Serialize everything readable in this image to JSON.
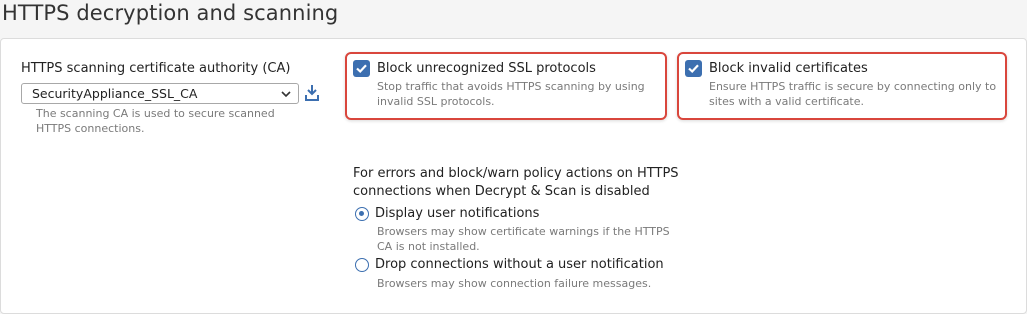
{
  "page": {
    "title": "HTTPS decryption and scanning"
  },
  "ca": {
    "label": "HTTPS scanning certificate authority (CA)",
    "selected": "SecurityAppliance_SSL_CA",
    "help": "The scanning CA is used to secure scanned HTTPS connections.",
    "download_icon": "download-icon"
  },
  "options": {
    "block_ssl": {
      "label": "Block unrecognized SSL protocols",
      "description": "Stop traffic that avoids HTTPS scanning by using invalid SSL protocols.",
      "checked": true
    },
    "block_invalid": {
      "label": "Block invalid certificates",
      "description": "Ensure HTTPS traffic is secure by connecting only to sites with a valid certificate.",
      "checked": true
    }
  },
  "errors": {
    "heading": "For errors and block/warn policy actions on HTTPS connections when Decrypt & Scan is disabled",
    "options": [
      {
        "label": "Display user notifications",
        "description": "Browsers may show certificate warnings if the HTTPS CA is not installed.",
        "selected": true
      },
      {
        "label": "Drop connections without a user notification",
        "description": "Browsers may show connection failure messages.",
        "selected": false
      }
    ]
  },
  "colors": {
    "accent": "#3c6fb0",
    "highlight_border": "#d9463c"
  }
}
